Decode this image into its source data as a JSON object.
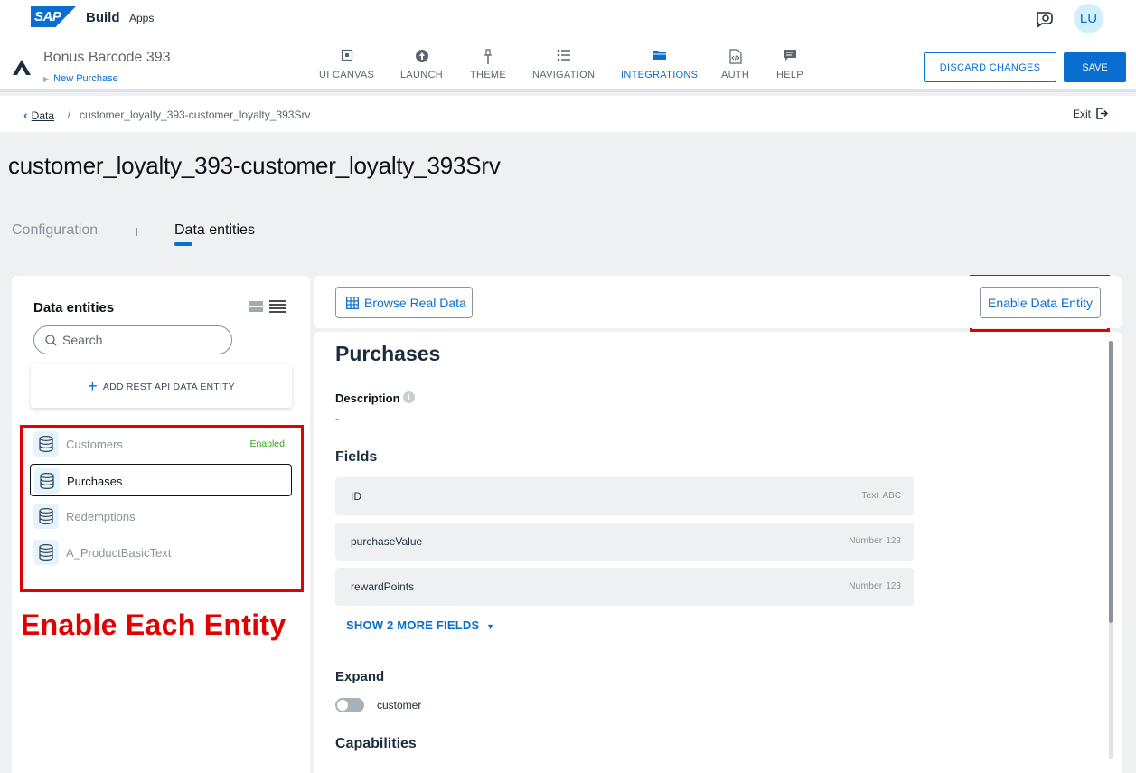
{
  "shell": {
    "logo_text": "SAP",
    "product": "Build",
    "product_sub": "Apps",
    "avatar_initials": "LU"
  },
  "app": {
    "name": "Bonus Barcode 393",
    "page": "New Purchase",
    "nav_tabs": [
      {
        "label": "UI CANVAS",
        "icon": "canvas-icon"
      },
      {
        "label": "LAUNCH",
        "icon": "launch-icon"
      },
      {
        "label": "THEME",
        "icon": "theme-icon"
      },
      {
        "label": "NAVIGATION",
        "icon": "navigation-icon"
      },
      {
        "label": "INTEGRATIONS",
        "icon": "folder-icon",
        "active": true
      },
      {
        "label": "AUTH",
        "icon": "auth-icon"
      },
      {
        "label": "HELP",
        "icon": "help-icon"
      }
    ],
    "discard_label": "DISCARD CHANGES",
    "save_label": "SAVE",
    "accent": "#0a6ed1"
  },
  "breadcrumb": {
    "root": "Data",
    "separator": "/",
    "current": "customer_loyalty_393-customer_loyalty_393Srv",
    "exit_label": "Exit"
  },
  "page_title": "customer_loyalty_393-customer_loyalty_393Srv",
  "tabs": [
    {
      "label": "Configuration",
      "active": false
    },
    {
      "label": "Data entities",
      "active": true
    }
  ],
  "left_panel": {
    "title": "Data entities",
    "search_placeholder": "Search",
    "add_rest_label": "ADD REST API DATA ENTITY",
    "entities": [
      {
        "name": "Customers",
        "status": "Enabled",
        "selected": false
      },
      {
        "name": "Purchases",
        "status": "",
        "selected": true
      },
      {
        "name": "Redemptions",
        "status": "",
        "selected": false
      },
      {
        "name": "A_ProductBasicText",
        "status": "",
        "selected": false
      }
    ]
  },
  "annotation": {
    "text": "Enable Each Entity",
    "color": "#e30000"
  },
  "toolbar": {
    "browse_label": "Browse Real Data",
    "enable_label": "Enable Data Entity"
  },
  "entity_detail": {
    "title": "Purchases",
    "description_label": "Description",
    "description_value": "-",
    "fields_heading": "Fields",
    "fields": [
      {
        "name": "ID",
        "type": "Text",
        "glyph": "ABC"
      },
      {
        "name": "purchaseValue",
        "type": "Number",
        "glyph": "123"
      },
      {
        "name": "rewardPoints",
        "type": "Number",
        "glyph": "123"
      }
    ],
    "show_more_label": "SHOW 2 MORE FIELDS",
    "expand_heading": "Expand",
    "expand_items": [
      {
        "name": "customer",
        "on": false
      }
    ],
    "capabilities_heading": "Capabilities"
  }
}
